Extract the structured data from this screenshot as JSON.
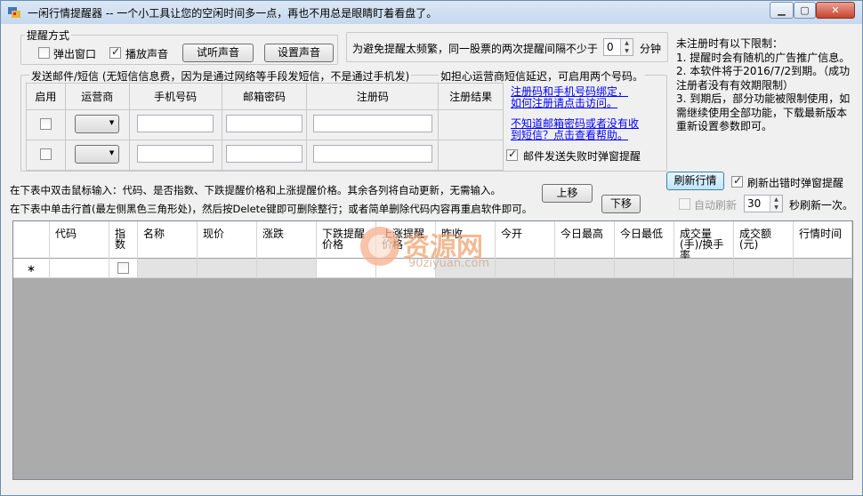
{
  "window": {
    "title": "一闲行情提醒器 -- 一个小工具让您的空闲时间多一点，再也不用总是眼睛盯着看盘了。",
    "controls": [
      "minimize",
      "maximize",
      "close"
    ]
  },
  "reminder": {
    "group_label": "提醒方式",
    "popup_label": "弹出窗口",
    "popup_checked": false,
    "sound_label": "播放声音",
    "sound_checked": true,
    "test_sound_button": "试听声音",
    "set_sound_button": "设置声音"
  },
  "interval": {
    "label": "为避免提醒太频繁，同一股票的两次提醒间隔不少于",
    "value": "0",
    "unit": "分钟"
  },
  "notice": {
    "lines": [
      "未注册时有以下限制：",
      "1. 提醒时会有随机的广告推广信息。",
      "2. 本软件将于2016/7/2到期。（成功",
      "注册者没有有效期限制）",
      "3. 到期后，部分功能被限制使用，如",
      "需继续使用全部功能，下载最新版本",
      "重新设置参数即可。"
    ]
  },
  "sms": {
    "group_label": "发送邮件/短信 (无短信信息费，因为是通过网络等手段发短信，不是通过手机发)",
    "hint": "如担心运营商短信延迟，可启用两个号码。",
    "columns": [
      "启用",
      "运营商",
      "手机号码",
      "邮箱密码",
      "注册码",
      "注册结果"
    ],
    "link1": "注册码和手机号码绑定，如何注册请点击访问。",
    "link1a": "注册码和手机号码绑定，",
    "link1b": "如何注册请点击访问。",
    "link2a": "不知道邮箱密码或者没有收",
    "link2b": "到短信？点击查看帮助。",
    "fail_popup_label": "邮件发送失败时弹窗提醒",
    "fail_popup_checked": true
  },
  "instructions": {
    "line1": "在下表中双击鼠标输入：代码、是否指数、下跌提醒价格和上涨提醒价格。其余各列将自动更新，无需输入。",
    "line2": "在下表中单击行首(最左侧黑色三角形处)，然后按Delete键即可删除整行；或者简单删除代码内容再重启软件即可。",
    "up_button": "上移",
    "down_button": "下移"
  },
  "refresh": {
    "refresh_button": "刷新行情",
    "error_popup_label": "刷新出错时弹窗提醒",
    "error_popup_checked": true,
    "auto_label": "自动刷新",
    "auto_checked": false,
    "seconds_value": "30",
    "seconds_suffix": "秒刷新一次。"
  },
  "grid": {
    "columns": [
      "代码",
      "指数",
      "名称",
      "现价",
      "涨跌",
      "下跌提醒价格",
      "上涨提醒价格",
      "昨收",
      "今开",
      "今日最高",
      "今日最低",
      "成交量(手)/换手率",
      "成交额(元)",
      "行情时间"
    ],
    "new_row_marker": "∗"
  },
  "watermark": {
    "brand": "资源网",
    "url": "90ziyuan.com"
  }
}
